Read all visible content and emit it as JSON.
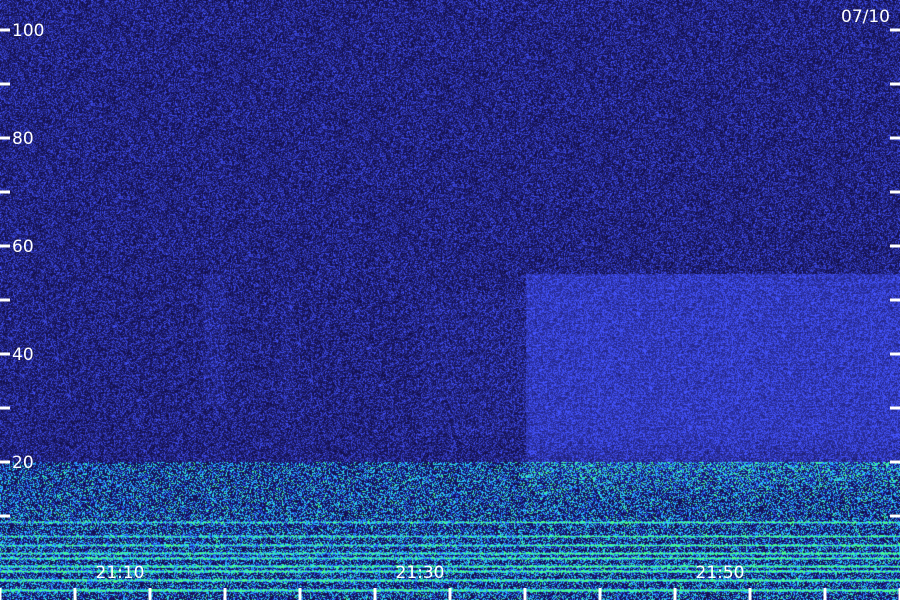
{
  "date_label": "07/10",
  "chart_data": {
    "type": "heatmap",
    "title": "",
    "xlabel": "",
    "ylabel": "",
    "ylim": [
      0,
      100
    ],
    "y_ticks_major": [
      20,
      40,
      60,
      80,
      100
    ],
    "y_ticks_minor": [
      10,
      30,
      50,
      70,
      90
    ],
    "x_range_minutes": [
      "21:02",
      "21:62"
    ],
    "x_tick_labels": [
      "21:10",
      "21:30",
      "21:50"
    ],
    "x_major_ticks": [
      "21:10",
      "21:20",
      "21:30",
      "21:40",
      "21:50",
      "21:60"
    ],
    "colors": {
      "background": "#15105a",
      "noise_low": "#1b1c9a",
      "noise_high": "#3a50ff",
      "band_cyan": "#22c8ff",
      "band_green": "#44ff88"
    },
    "features": [
      {
        "name": "weak emission burst",
        "x_start": "21:16",
        "x_end": "21:17",
        "y_range": [
          30,
          55
        ]
      },
      {
        "name": "enhanced emission",
        "x_start": "21:37",
        "x_end": "21:62",
        "y_range": [
          25,
          55
        ]
      },
      {
        "name": "low-frequency bands",
        "x_start": "21:02",
        "x_end": "21:62",
        "y_range": [
          0,
          20
        ]
      }
    ]
  }
}
